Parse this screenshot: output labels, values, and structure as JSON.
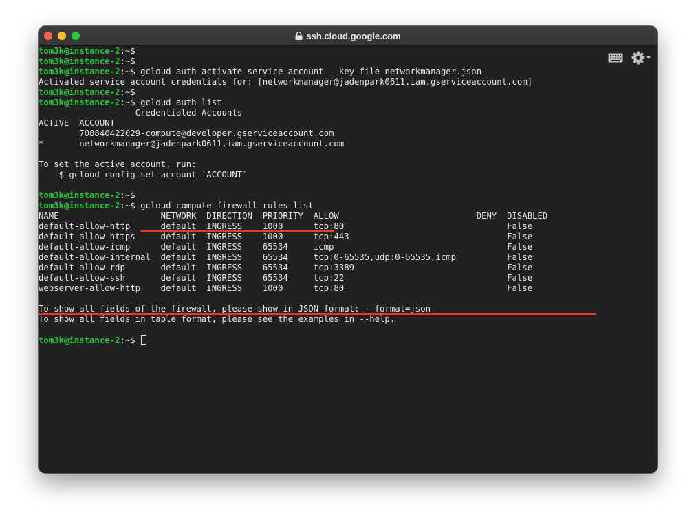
{
  "window": {
    "title": "ssh.cloud.google.com"
  },
  "colors": {
    "prompt": "#27c93f",
    "annotation": "#e83a28",
    "background": "#212121"
  },
  "prompt": {
    "user": "tom3k@instance-2",
    "sep": ":~$ "
  },
  "commands": {
    "c1": "gcloud auth activate-service-account --key-file networkmanager.json",
    "c2": "gcloud auth list",
    "c3": "gcloud compute firewall-rules list"
  },
  "output": {
    "activated": "Activated service account credentials for: [networkmanager@jadenpark0611.iam.gserviceaccount.com]",
    "cred_header": "                   Credentialed Accounts",
    "acct_cols": "ACTIVE  ACCOUNT",
    "acct1": "        708840422029-compute@developer.gserviceaccount.com",
    "acct2": "*       networkmanager@jadenpark0611.iam.gserviceaccount.com",
    "tip1": "To set the active account, run:",
    "tip2": "    $ gcloud config set account `ACCOUNT`",
    "fw_header": "NAME                    NETWORK  DIRECTION  PRIORITY  ALLOW                           DENY  DISABLED",
    "fw_rows": [
      "default-allow-http      default  INGRESS    1000      tcp:80                                False",
      "default-allow-https     default  INGRESS    1000      tcp:443                               False",
      "default-allow-icmp      default  INGRESS    65534     icmp                                  False",
      "default-allow-internal  default  INGRESS    65534     tcp:0-65535,udp:0-65535,icmp          False",
      "default-allow-rdp       default  INGRESS    65534     tcp:3389                              False",
      "default-allow-ssh       default  INGRESS    65534     tcp:22                                False",
      "webserver-allow-http    default  INGRESS    1000      tcp:80                                False"
    ],
    "note1": "To show all fields of the firewall, please show in JSON format: --format=json",
    "note2": "To show all fields in table format, please see the examples in --help."
  }
}
